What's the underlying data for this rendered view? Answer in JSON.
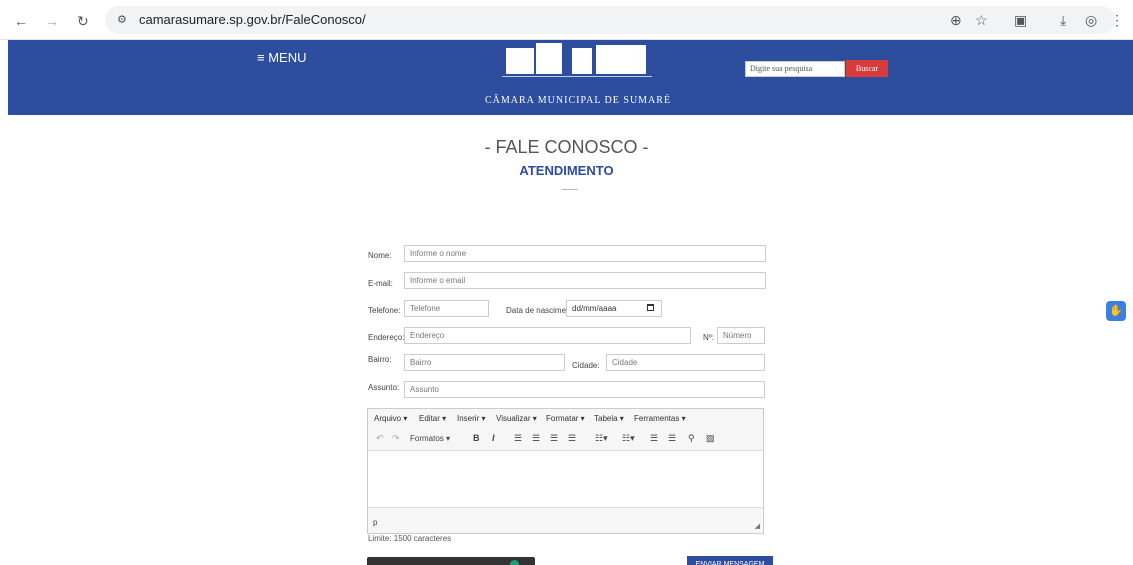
{
  "browser": {
    "url": "camarasumare.sp.gov.br/FaleConosco/",
    "icons": [
      "back-arrow",
      "forward-arrow",
      "reload",
      "site-settings",
      "zoom",
      "star",
      "extensions",
      "download",
      "profile",
      "more-menu"
    ]
  },
  "header": {
    "menu_label": "≡ MENU",
    "logo_text": "CÂMARA MUNICIPAL DE SUMARÉ",
    "search_placeholder": "Digite sua pesquisa",
    "search_button": "Buscar",
    "bg_color": "#2d4d9e"
  },
  "page": {
    "title": "- FALE CONOSCO -",
    "subtitle": "ATENDIMENTO"
  },
  "form": {
    "nome_label": "Nome:",
    "nome_placeholder": "Informe o nome",
    "email_label": "E-mail:",
    "email_placeholder": "Informe o email",
    "telefone_label": "Telefone:",
    "telefone_placeholder": "Telefone",
    "nascimento_label": "Data de nascimento:",
    "nascimento_value": "dd/mm/aaaa",
    "endereco_label": "Endereço:",
    "endereco_placeholder": "Endereço",
    "numero_label": "Nº:",
    "numero_placeholder": "Número",
    "bairro_label": "Bairro:",
    "bairro_placeholder": "Bairro",
    "cidade_label": "Cidade:",
    "cidade_placeholder": "Cidade",
    "assunto_label": "Assunto:",
    "assunto_placeholder": "Assunto"
  },
  "editor": {
    "menus": [
      "Arquivo ▾",
      "Editar ▾",
      "Inserir ▾",
      "Visualizar ▾",
      "Formatar ▾",
      "Tabela ▾",
      "Ferramentas ▾"
    ],
    "formats_label": "Formatos ▾",
    "status_path": "p",
    "limit_text": "Limite: 1500 caracteres"
  },
  "actions": {
    "send_label": "ENVIAR MENSAGEM"
  }
}
